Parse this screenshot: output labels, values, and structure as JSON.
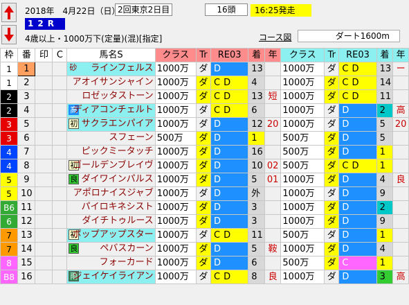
{
  "race": {
    "date": "2018年　4月22日（日）",
    "meeting": "2回東京2日目",
    "heads": "16頭",
    "post_time": "16:25発走",
    "race_no": "12R",
    "conditions": "4歳以上・1000万下(定量)(混)[指定]",
    "course_link": "コース図",
    "course": "ダート1600m"
  },
  "colors": {
    "waku": {
      "1": {
        "bg": "#ffffff",
        "fg": "#000000"
      },
      "2": {
        "bg": "#000000",
        "fg": "#ffffff"
      },
      "3": {
        "bg": "#e60000",
        "fg": "#ffffff"
      },
      "4": {
        "bg": "#0044ff",
        "fg": "#ffffff"
      },
      "5": {
        "bg": "#ffff00",
        "fg": "#000000"
      },
      "6": {
        "bg": "#33aa33",
        "fg": "#ffffff"
      },
      "7": {
        "bg": "#ff9900",
        "fg": "#000000"
      },
      "8": {
        "bg": "#ff66ff",
        "fg": "#ffffff"
      }
    },
    "header_pink": "#ff8c8c",
    "header_cyan": "#8cf0f0"
  },
  "headers": [
    "枠",
    "番",
    "印",
    "C",
    "馬名S",
    "クラス",
    "Tr",
    "RE03",
    "着",
    "年",
    "クラス",
    "Tr",
    "RE03",
    "着",
    "年"
  ],
  "horses": [
    {
      "waku": "1",
      "waku_label": "1",
      "uma": "1",
      "uma_highlight": true,
      "in": "",
      "badge": "砂",
      "badge_type": "sand",
      "name": "ラインフェルス",
      "name_bg": "cyan",
      "r1": {
        "cls": "1000万",
        "tr": "ダ",
        "tr_y": false,
        "ri": "D",
        "ri_t": "blue",
        "ch": "13",
        "ch_t": "gray",
        "nen": ""
      },
      "r2": {
        "cls": "1000万",
        "tr": "ダ",
        "tr_y": false,
        "ri": "CD",
        "ri_t": "ylw",
        "ch": "13",
        "ch_t": "gray",
        "nen": "ー"
      }
    },
    {
      "waku": "1",
      "waku_label": "1",
      "uma": "2",
      "uma_highlight": false,
      "in": "",
      "badge": "",
      "badge_type": "",
      "name": "アオイサンシャイン",
      "name_bg": "",
      "r1": {
        "cls": "1000万",
        "tr": "ダ",
        "tr_y": true,
        "ri": "CD",
        "ri_t": "ylw",
        "ch": "4",
        "ch_t": "gray",
        "nen": ""
      },
      "r2": {
        "cls": "1000万",
        "tr": "ダ",
        "tr_y": true,
        "ri": "CD",
        "ri_t": "ylw",
        "ch": "14",
        "ch_t": "gray",
        "nen": ""
      }
    },
    {
      "waku": "2",
      "waku_label": "2",
      "uma": "3",
      "uma_highlight": false,
      "in": "",
      "badge": "",
      "badge_type": "",
      "name": "ロゼッタストーン",
      "name_bg": "",
      "r1": {
        "cls": "1000万",
        "tr": "ダ",
        "tr_y": true,
        "ri": "CD",
        "ri_t": "ylw",
        "ch": "13",
        "ch_t": "gray",
        "nen": "短"
      },
      "r2": {
        "cls": "1000万",
        "tr": "ダ",
        "tr_y": true,
        "ri": "CD",
        "ri_t": "ylw",
        "ch": "11",
        "ch_t": "gray",
        "nen": ""
      }
    },
    {
      "waku": "2",
      "waku_label": "2",
      "uma": "4",
      "uma_highlight": false,
      "in": "",
      "badge": "高",
      "badge_type": "blue",
      "name": "ディアコンチェルト",
      "name_bg": "cyan",
      "r1": {
        "cls": "1000万",
        "tr": "ダ",
        "tr_y": false,
        "ri": "CD",
        "ri_t": "ylw",
        "ch": "6",
        "ch_t": "gray",
        "nen": ""
      },
      "r2": {
        "cls": "1000万",
        "tr": "ダ",
        "tr_y": false,
        "ri": "D",
        "ri_t": "blue",
        "ch": "2",
        "ch_t": "cyan",
        "nen": "高"
      }
    },
    {
      "waku": "3",
      "waku_label": "3",
      "uma": "5",
      "uma_highlight": false,
      "in": "",
      "badge": "初",
      "badge_type": "yellow",
      "name": "サクラエンパイア",
      "name_bg": "cyan",
      "r1": {
        "cls": "1000万",
        "tr": "ダ",
        "tr_y": false,
        "ri": "D",
        "ri_t": "blue",
        "ch": "12",
        "ch_t": "gray",
        "nen": "20"
      },
      "r2": {
        "cls": "1000万",
        "tr": "ダ",
        "tr_y": false,
        "ri": "D",
        "ri_t": "blue",
        "ch": "5",
        "ch_t": "gray",
        "nen": "20"
      }
    },
    {
      "waku": "3",
      "waku_label": "3",
      "uma": "6",
      "uma_highlight": false,
      "in": "",
      "badge": "",
      "badge_type": "",
      "name": "スフェーン",
      "name_bg": "",
      "r1": {
        "cls": "500万",
        "tr": "ダ",
        "tr_y": true,
        "ri": "D",
        "ri_t": "blue",
        "ch": "1",
        "ch_t": "ylw",
        "nen": ""
      },
      "r2": {
        "cls": "500万",
        "tr": "ダ",
        "tr_y": true,
        "ri": "D",
        "ri_t": "blue",
        "ch": "5",
        "ch_t": "gray",
        "nen": ""
      }
    },
    {
      "waku": "4",
      "waku_label": "4",
      "uma": "7",
      "uma_highlight": false,
      "in": "",
      "badge": "",
      "badge_type": "",
      "name": "ピックミータッチ",
      "name_bg": "",
      "r1": {
        "cls": "1000万",
        "tr": "ダ",
        "tr_y": true,
        "ri": "D",
        "ri_t": "blue",
        "ch": "16",
        "ch_t": "gray",
        "nen": ""
      },
      "r2": {
        "cls": "500万",
        "tr": "ダ",
        "tr_y": true,
        "ri": "D",
        "ri_t": "blue",
        "ch": "1",
        "ch_t": "ylw",
        "nen": ""
      }
    },
    {
      "waku": "4",
      "waku_label": "4",
      "uma": "8",
      "uma_highlight": false,
      "in": "",
      "badge": "初",
      "badge_type": "yellow",
      "name": "ゴールデンブレイヴ",
      "name_bg": "",
      "r1": {
        "cls": "1000万",
        "tr": "ダ",
        "tr_y": true,
        "ri": "D",
        "ri_t": "blue",
        "ch": "10",
        "ch_t": "gray",
        "nen": "02"
      },
      "r2": {
        "cls": "500万",
        "tr": "ダ",
        "tr_y": true,
        "ri": "CD",
        "ri_t": "ylw",
        "ch": "1",
        "ch_t": "ylw",
        "nen": ""
      }
    },
    {
      "waku": "5",
      "waku_label": "5",
      "uma": "9",
      "uma_highlight": false,
      "in": "",
      "badge": "良",
      "badge_type": "green",
      "name": "ダイワインパルス",
      "name_bg": "",
      "r1": {
        "cls": "1000万",
        "tr": "ダ",
        "tr_y": true,
        "ri": "D",
        "ri_t": "blue",
        "ch": "5",
        "ch_t": "gray",
        "nen": "01"
      },
      "r2": {
        "cls": "1000万",
        "tr": "ダ",
        "tr_y": true,
        "ri": "D",
        "ri_t": "blue",
        "ch": "4",
        "ch_t": "gray",
        "nen": "良"
      }
    },
    {
      "waku": "5",
      "waku_label": "5",
      "uma": "10",
      "uma_highlight": false,
      "in": "",
      "badge": "",
      "badge_type": "",
      "name": "アポロナイスジャブ",
      "name_bg": "",
      "r1": {
        "cls": "1000万",
        "tr": "ダ",
        "tr_y": false,
        "ri": "D",
        "ri_t": "blue",
        "ch": "外",
        "ch_t": "gray",
        "nen": ""
      },
      "r2": {
        "cls": "1000万",
        "tr": "ダ",
        "tr_y": false,
        "ri": "D",
        "ri_t": "blue",
        "ch": "9",
        "ch_t": "gray",
        "nen": ""
      }
    },
    {
      "waku": "6",
      "waku_label": "B6",
      "uma": "11",
      "uma_highlight": false,
      "in": "",
      "badge": "",
      "badge_type": "",
      "name": "パイロキネシスト",
      "name_bg": "",
      "r1": {
        "cls": "1000万",
        "tr": "ダ",
        "tr_y": true,
        "ri": "D",
        "ri_t": "blue",
        "ch": "3",
        "ch_t": "gray",
        "nen": ""
      },
      "r2": {
        "cls": "1000万",
        "tr": "ダ",
        "tr_y": true,
        "ri": "D",
        "ri_t": "blue",
        "ch": "2",
        "ch_t": "cyan",
        "nen": ""
      }
    },
    {
      "waku": "6",
      "waku_label": "6",
      "uma": "12",
      "uma_highlight": false,
      "in": "",
      "badge": "",
      "badge_type": "",
      "name": "ダイチトゥルース",
      "name_bg": "",
      "r1": {
        "cls": "1000万",
        "tr": "ダ",
        "tr_y": true,
        "ri": "D",
        "ri_t": "blue",
        "ch": "3",
        "ch_t": "gray",
        "nen": ""
      },
      "r2": {
        "cls": "1000万",
        "tr": "ダ",
        "tr_y": true,
        "ri": "D",
        "ri_t": "blue",
        "ch": "9",
        "ch_t": "gray",
        "nen": ""
      }
    },
    {
      "waku": "7",
      "waku_label": "7",
      "uma": "13",
      "uma_highlight": false,
      "in": "",
      "badge": "初",
      "badge_type": "yellow",
      "name": "ポップアップスター",
      "name_bg": "cyan",
      "r1": {
        "cls": "1000万",
        "tr": "ダ",
        "tr_y": false,
        "ri": "CD",
        "ri_t": "ylw",
        "ch": "11",
        "ch_t": "gray",
        "nen": ""
      },
      "r2": {
        "cls": "500万",
        "tr": "ダ",
        "tr_y": false,
        "ri": "D",
        "ri_t": "blue",
        "ch": "1",
        "ch_t": "ylw",
        "nen": ""
      }
    },
    {
      "waku": "7",
      "waku_label": "7",
      "uma": "14",
      "uma_highlight": false,
      "in": "",
      "badge": "良",
      "badge_type": "green",
      "name": "ペバスカーン",
      "name_bg": "",
      "r1": {
        "cls": "1000万",
        "tr": "ダ",
        "tr_y": true,
        "ri": "D",
        "ri_t": "blue",
        "ch": "5",
        "ch_t": "gray",
        "nen": "鞍"
      },
      "r2": {
        "cls": "1000万",
        "tr": "ダ",
        "tr_y": true,
        "ri": "D",
        "ri_t": "blue",
        "ch": "4",
        "ch_t": "gray",
        "nen": ""
      }
    },
    {
      "waku": "8",
      "waku_label": "8",
      "uma": "15",
      "uma_highlight": false,
      "in": "",
      "badge": "",
      "badge_type": "",
      "name": "フォーカード",
      "name_bg": "",
      "r1": {
        "cls": "1000万",
        "tr": "ダ",
        "tr_y": true,
        "ri": "D",
        "ri_t": "blue",
        "ch": "6",
        "ch_t": "gray",
        "nen": ""
      },
      "r2": {
        "cls": "500万",
        "tr": "ダ",
        "tr_y": true,
        "ri": "C",
        "ri_t": "mag",
        "ch": "1",
        "ch_t": "ylw",
        "nen": ""
      }
    },
    {
      "waku": "8",
      "waku_label": "B8",
      "uma": "16",
      "uma_highlight": false,
      "in": "",
      "badge": "雨",
      "badge_type": "teal",
      "name": "ジェイケイライアン",
      "name_bg": "cyan",
      "r1": {
        "cls": "1000万",
        "tr": "ダ",
        "tr_y": false,
        "ri": "CD",
        "ri_t": "ylw",
        "ch": "8",
        "ch_t": "gray",
        "nen": "良"
      },
      "r2": {
        "cls": "1000万",
        "tr": "ダ",
        "tr_y": false,
        "ri": "D",
        "ri_t": "blue",
        "ch": "3",
        "ch_t": "green",
        "nen": "高"
      }
    }
  ]
}
